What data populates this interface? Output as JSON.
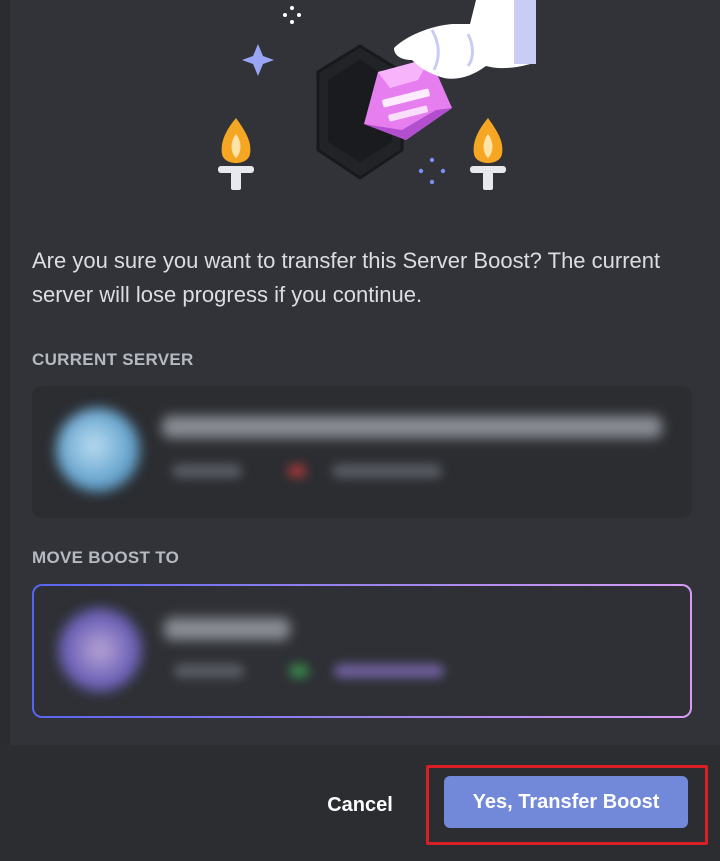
{
  "dialog": {
    "question": "Are you sure you want to transfer this Server Boost? The current server will lose progress if you continue."
  },
  "current_server": {
    "section_label": "CURRENT SERVER"
  },
  "move_boost_to": {
    "section_label": "MOVE BOOST TO"
  },
  "footer": {
    "cancel_label": "Cancel",
    "confirm_label": "Yes, Transfer Boost"
  },
  "colors": {
    "background": "#313338",
    "footer": "#2b2d31",
    "confirm_button": "#7289da",
    "highlight_border": "#d81f26",
    "selected_gradient": [
      "#5865f2",
      "#9b84ec",
      "#d89cf6"
    ]
  },
  "icons": [
    "sparkle-icon",
    "torch-icon",
    "boost-gem-icon",
    "hand-icon"
  ]
}
